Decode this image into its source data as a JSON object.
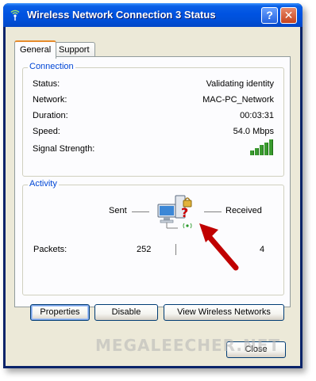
{
  "window": {
    "title": "Wireless Network Connection 3 Status",
    "help_label": "?",
    "close_glyph": "✕"
  },
  "tabs": [
    {
      "label": "General",
      "active": true
    },
    {
      "label": "Support",
      "active": false
    }
  ],
  "connection": {
    "group_label": "Connection",
    "rows": [
      {
        "label": "Status:",
        "value": "Validating identity"
      },
      {
        "label": "Network:",
        "value": "MAC-PC_Network"
      },
      {
        "label": "Duration:",
        "value": "00:03:31"
      },
      {
        "label": "Speed:",
        "value": "54.0 Mbps"
      }
    ],
    "signal_label": "Signal Strength:",
    "signal_bars_lit": 5,
    "signal_color": "#3a9b2f"
  },
  "activity": {
    "group_label": "Activity",
    "sent_label": "Sent",
    "received_label": "Received",
    "packets_label": "Packets:",
    "packets_sent": "252",
    "packets_received": "4",
    "icon": "network-computer-validating-icon"
  },
  "buttons": {
    "properties": "Properties",
    "disable": "Disable",
    "view_networks": "View Wireless Networks",
    "close": "Close"
  },
  "watermark": "MEGALEECHER.NET",
  "colors": {
    "titlebar": "#0053e1",
    "group_label": "#0046d5",
    "client_bg": "#ece9d8",
    "annotation_arrow": "#c00000"
  }
}
